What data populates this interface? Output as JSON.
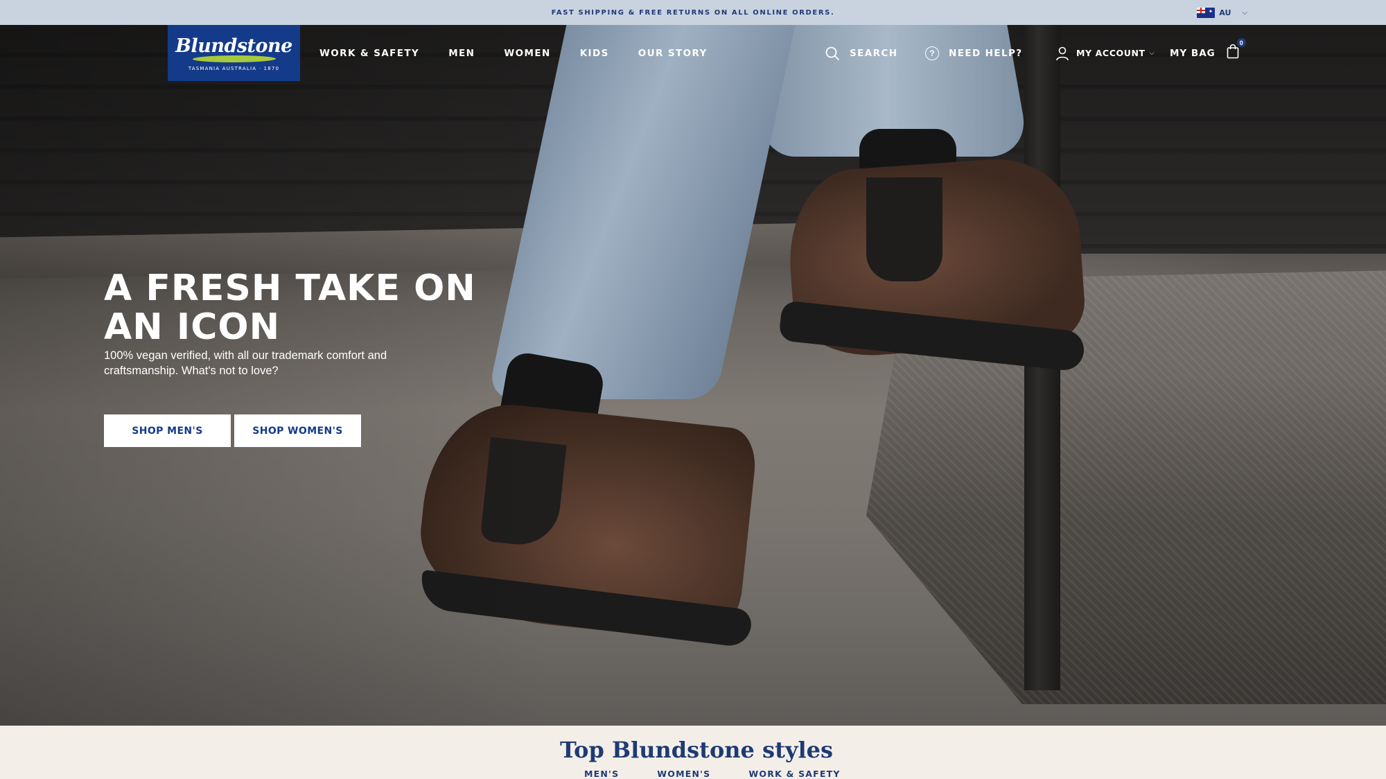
{
  "announcement": {
    "text": "FAST SHIPPING & FREE RETURNS ON ALL ONLINE ORDERS."
  },
  "region": {
    "code": "AU",
    "flag_icon": "australia-flag-icon"
  },
  "logo": {
    "wordmark": "Blundstone",
    "tagline": "TASMANIA AUSTRALIA · 1870",
    "bg_color": "#143a8a"
  },
  "nav": {
    "items": [
      "WORK & SAFETY",
      "MEN",
      "WOMEN",
      "KIDS",
      "OUR STORY"
    ]
  },
  "utilities": {
    "search": "SEARCH",
    "help": "NEED HELP?",
    "help_icon_glyph": "?",
    "account": "MY ACCOUNT",
    "bag": "MY BAG",
    "bag_count": "0"
  },
  "hero": {
    "title": "A FRESH TAKE ON AN ICON",
    "subtitle": "100% vegan verified, with all our trademark comfort and craftsmanship. What's not to love?",
    "buttons": {
      "mens": "SHOP MEN'S",
      "womens": "SHOP WOMEN'S"
    }
  },
  "styles_section": {
    "title": "Top Blundstone styles",
    "tabs": [
      "MEN'S",
      "WOMEN'S",
      "WORK & SAFETY"
    ]
  },
  "colors": {
    "brand_blue": "#143a8a",
    "announcement_bg": "#c9d3e0",
    "section_bg": "#f3efe8"
  }
}
